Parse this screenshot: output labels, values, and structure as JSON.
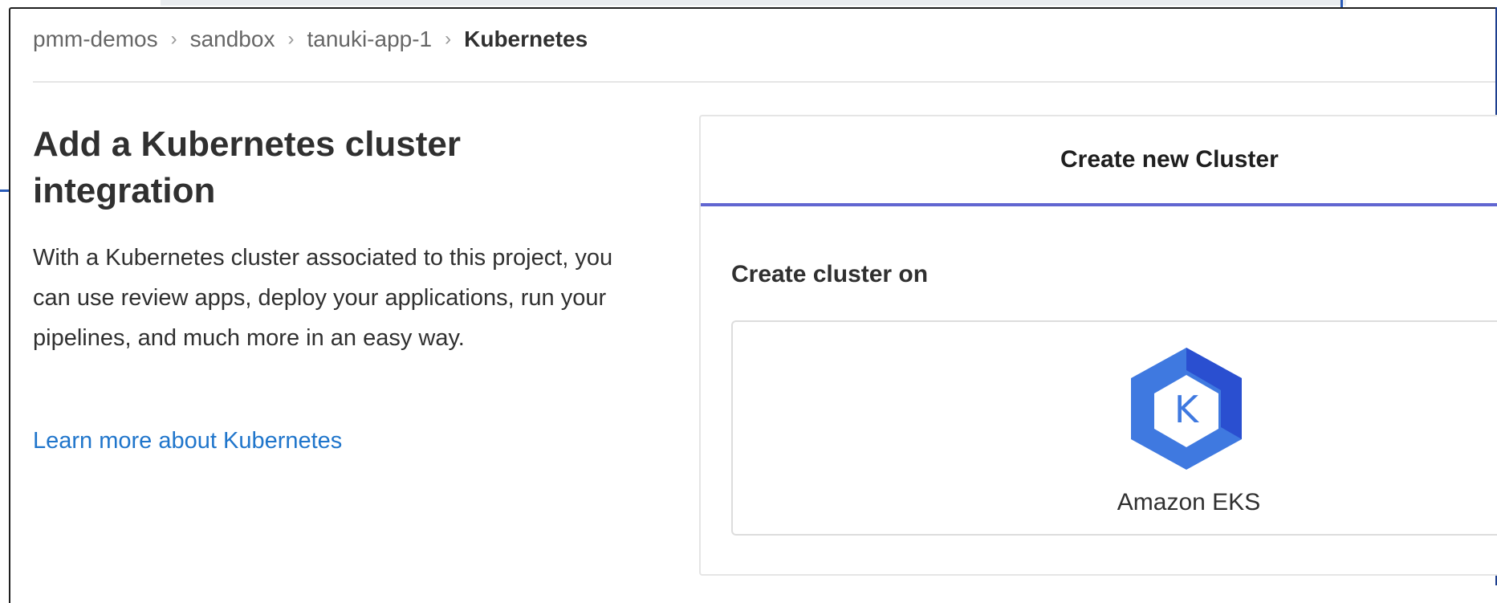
{
  "breadcrumb": {
    "items": [
      "pmm-demos",
      "sandbox",
      "tanuki-app-1"
    ],
    "separator": "›",
    "current": "Kubernetes"
  },
  "intro": {
    "title": "Add a Kubernetes cluster integration",
    "description": "With a Kubernetes cluster associated to this project, you can use review apps, deploy your applications, run your pipelines, and much more in an easy way.",
    "learn_more": "Learn more about Kubernetes"
  },
  "card": {
    "tab_label": "Create new Cluster",
    "section_label": "Create cluster on",
    "provider": {
      "name": "Amazon EKS",
      "icon": "kubernetes-eks-logo-icon",
      "logo_letter": "K"
    }
  },
  "colors": {
    "accent": "#6166d1",
    "link": "#1f75cb",
    "eks_blue": "#3f79e0",
    "eks_dark": "#2a4fd0"
  }
}
